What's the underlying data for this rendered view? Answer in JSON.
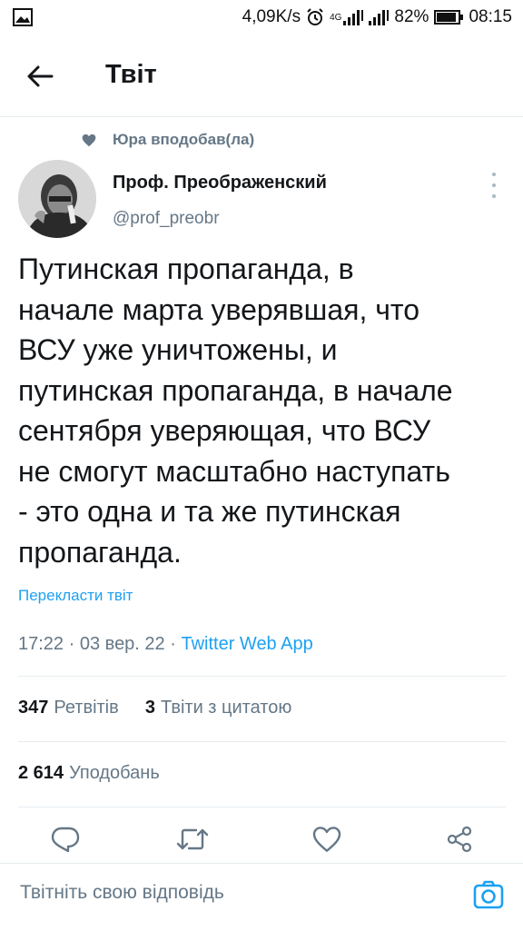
{
  "status_bar": {
    "speed": "4,09K/s",
    "network": "4G",
    "battery": "82%",
    "time": "08:15",
    "icons": [
      "gallery-icon",
      "alarm-icon",
      "signal-icon",
      "signal-icon",
      "battery-icon"
    ]
  },
  "header": {
    "title": "Твіт",
    "back_icon": "arrow-left-icon"
  },
  "social_context": {
    "icon": "heart-icon",
    "text": "Юра вподобав(ла)"
  },
  "author": {
    "name": "Проф. Преображенский",
    "handle": "@prof_preobr"
  },
  "tweet": {
    "text": "Путинская пропаганда, в\nначале марта уверявшая, что\nВСУ уже уничтожены, и\nпутинская пропаганда, в начале\nсентября уверяющая, что ВСУ\nне смогут масштабно наступать\n- это одна и та же путинская\nпропаганда.",
    "translate_label": "Перекласти твіт",
    "time": "17:22",
    "date": "03 вер. 22",
    "separator": "·",
    "source": "Twitter Web App"
  },
  "stats": {
    "retweets_count": "347",
    "retweets_label": "Ретвітів",
    "quotes_count": "3",
    "quotes_label": "Твіти з цитатою",
    "likes_count": "2 614",
    "likes_label": "Уподобань"
  },
  "actions": [
    "reply-icon",
    "retweet-icon",
    "like-icon",
    "share-icon"
  ],
  "reply": {
    "placeholder": "Твітніть свою відповідь",
    "camera_icon": "camera-icon"
  },
  "colors": {
    "accent": "#1da1f2",
    "secondary_text": "#657786",
    "primary_text": "#14171a",
    "divider": "#e6ecf0"
  }
}
